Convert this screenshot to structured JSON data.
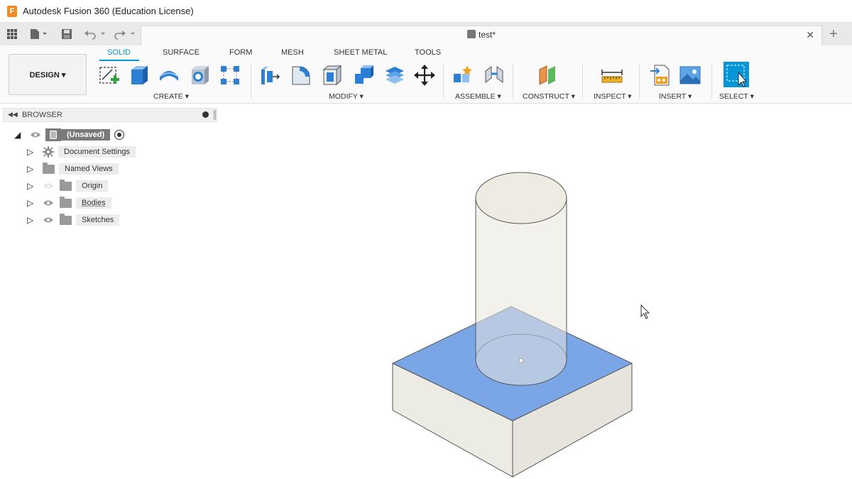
{
  "window": {
    "title": "Autodesk Fusion 360 (Education License)",
    "app_icon_letter": "F"
  },
  "document_tab": {
    "name": "test*",
    "close_symbol": "✕",
    "new_tab_symbol": "+"
  },
  "quick_access": {
    "grid_icon": "apps-grid-icon",
    "file_icon": "file-icon",
    "save_icon": "save-icon",
    "undo_icon": "undo-icon",
    "redo_icon": "redo-icon"
  },
  "toolbar": {
    "workspace_button": "DESIGN ▾",
    "tabs": [
      {
        "label": "SOLID",
        "active": true
      },
      {
        "label": "SURFACE",
        "active": false
      },
      {
        "label": "FORM",
        "active": false
      },
      {
        "label": "MESH",
        "active": false
      },
      {
        "label": "SHEET METAL",
        "active": false
      },
      {
        "label": "TOOLS",
        "active": false
      }
    ],
    "groups": [
      {
        "label": "CREATE ▾",
        "icons": [
          "create-sketch-icon",
          "extrude-icon",
          "revolve-icon",
          "hole-icon",
          "pattern-icon"
        ]
      },
      {
        "label": "MODIFY ▾",
        "icons": [
          "press-pull-icon",
          "fillet-icon",
          "shell-icon",
          "combine-icon",
          "replace-face-icon",
          "move-icon"
        ]
      },
      {
        "label": "ASSEMBLE ▾",
        "icons": [
          "new-component-icon",
          "joint-icon"
        ]
      },
      {
        "label": "CONSTRUCT ▾",
        "icons": [
          "offset-plane-icon"
        ]
      },
      {
        "label": "INSPECT ▾",
        "icons": [
          "measure-icon"
        ]
      },
      {
        "label": "INSERT ▾",
        "icons": [
          "insert-derive-icon",
          "insert-image-icon"
        ]
      },
      {
        "label": "SELECT ▾",
        "icons": [
          "select-icon"
        ]
      }
    ]
  },
  "browser": {
    "title": "BROWSER",
    "root": "(Unsaved)",
    "items": [
      {
        "label": "Document Settings",
        "icon": "gear-icon"
      },
      {
        "label": "Named Views",
        "icon": "folder-icon"
      },
      {
        "label": "Origin",
        "icon": "folder-icon"
      },
      {
        "label": "Bodies",
        "icon": "folder-icon"
      },
      {
        "label": "Sketches",
        "icon": "folder-icon"
      }
    ]
  },
  "colors": {
    "accent": "#0696d7",
    "selected_face": "#7aa6e8",
    "body": "#ece9e0"
  }
}
